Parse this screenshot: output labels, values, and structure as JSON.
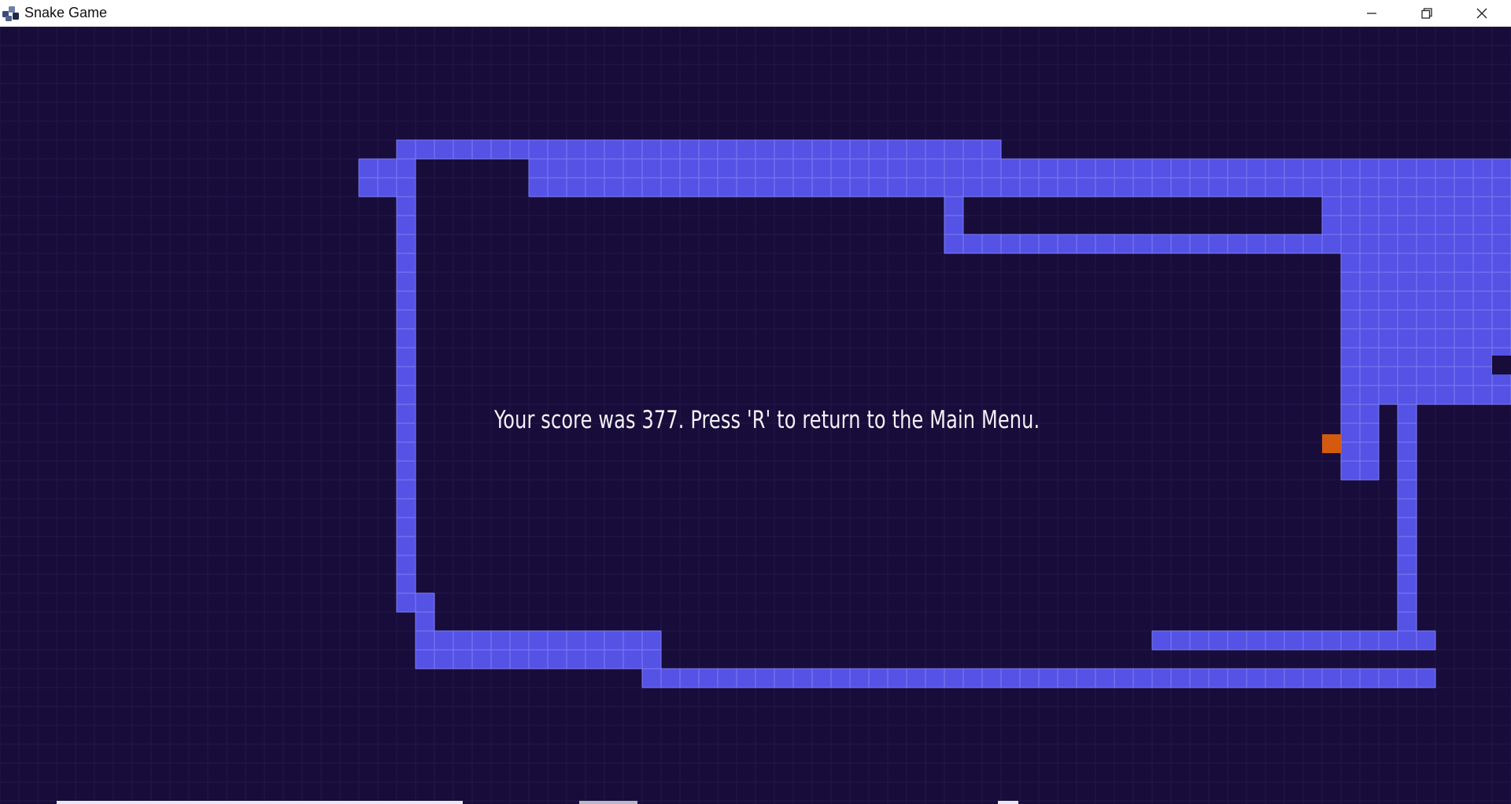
{
  "window": {
    "title": "Snake Game",
    "icons": {
      "app": "snake-game-app-icon",
      "minimize": "minimize-icon",
      "maximize": "restore-icon",
      "close": "close-icon"
    }
  },
  "game": {
    "message": "Your score was 377. Press 'R' to return to the Main Menu.",
    "colors": {
      "background": "#180c3a",
      "grid_line": "#24184c",
      "snake": "#5552e6",
      "snake_cell_border": "#7e7df0",
      "food": "#d45a10",
      "text": "#f2f2f6"
    }
  }
}
